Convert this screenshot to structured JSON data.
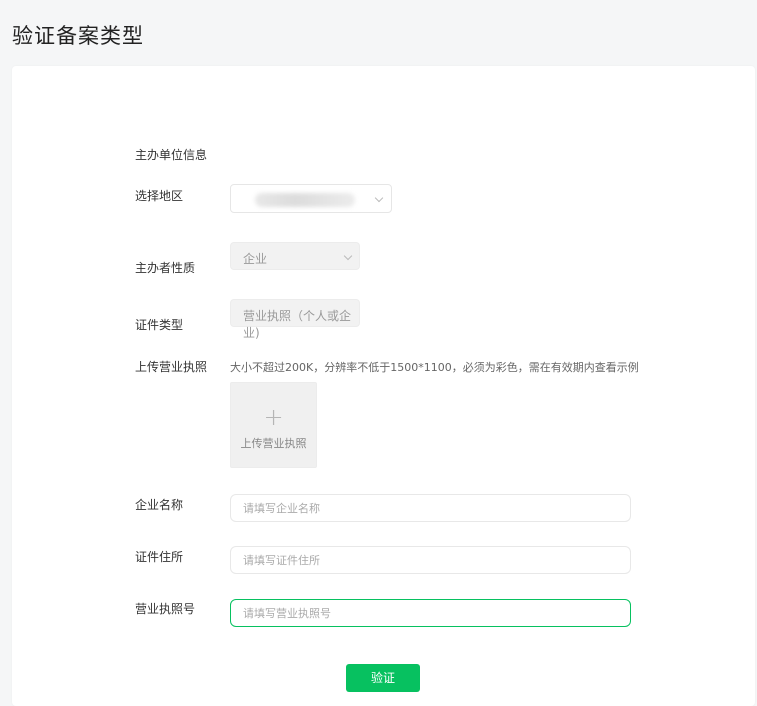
{
  "page": {
    "title": "验证备案类型"
  },
  "form": {
    "section_title": "主办单位信息",
    "region": {
      "label": "选择地区",
      "value": ""
    },
    "nature": {
      "label": "主办者性质",
      "value": "企业"
    },
    "cert_type": {
      "label": "证件类型",
      "value": "营业执照（个人或企业)"
    },
    "upload": {
      "label": "上传营业执照",
      "hint": "大小不超过200K，分辨率不低于1500*1100，必须为彩色，需在有效期内查看示例",
      "button_label": "上传营业执照",
      "plus_icon": "+"
    },
    "company_name": {
      "label": "企业名称",
      "placeholder": "请填写企业名称"
    },
    "cert_address": {
      "label": "证件住所",
      "placeholder": "请填写证件住所"
    },
    "license_no": {
      "label": "营业执照号",
      "placeholder": "请填写营业执照号"
    },
    "submit_label": "验证"
  },
  "colors": {
    "accent": "#07c160",
    "background": "#f5f6f7"
  }
}
